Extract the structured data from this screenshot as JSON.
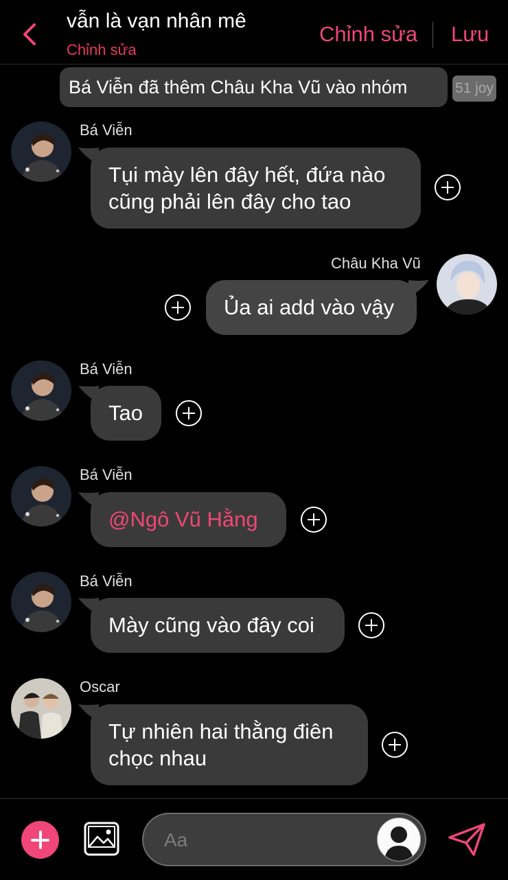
{
  "header": {
    "title": "vẫn là vạn nhân mê",
    "subtitle": "Chỉnh sửa",
    "edit_label": "Chỉnh sửa",
    "save_label": "Lưu",
    "accent": "#f0467a"
  },
  "system_message": {
    "text": "Bá Viễn đã thêm Châu Kha Vũ vào nhóm",
    "tag": "51 joy"
  },
  "messages": [
    {
      "sender": "Bá Viễn",
      "text_line1": "Tụi mày lên đây hết, đứa nào",
      "text_line2": "cũng phải lên đây cho tao",
      "direction": "incoming"
    },
    {
      "sender": "Châu Kha Vũ",
      "text": "Ủa ai add vào vậy",
      "direction": "outgoing"
    },
    {
      "sender": "Bá Viễn",
      "text": "Tao",
      "direction": "incoming"
    },
    {
      "sender": "Bá Viễn",
      "text": "@Ngô Vũ Hằng",
      "direction": "incoming",
      "mention": true
    },
    {
      "sender": "Bá Viễn",
      "text": "Mày cũng vào đây coi",
      "direction": "incoming"
    },
    {
      "sender": "Oscar",
      "text_line1": "Tự nhiên hai thằng điên",
      "text_line2": "chọc nhau",
      "direction": "incoming"
    }
  ],
  "composer": {
    "placeholder": "Aa"
  },
  "icons": [
    "back-chevron-icon",
    "add-reaction-icon",
    "plus-icon",
    "image-gallery-icon",
    "avatar-icon",
    "send-icon"
  ]
}
